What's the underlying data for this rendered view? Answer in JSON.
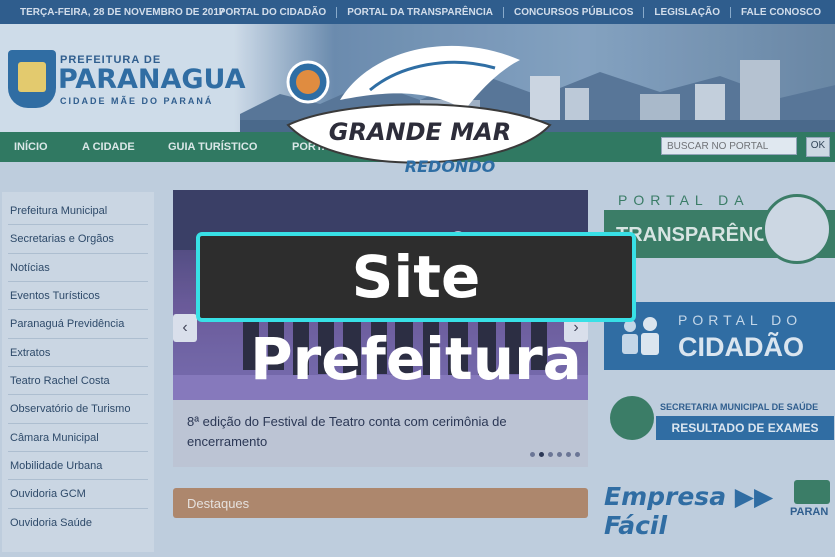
{
  "topbar": {
    "date": "TERÇA-FEIRA, 28 DE NOVEMBRO DE 2017",
    "links": [
      "PORTAL DO CIDADÃO",
      "PORTAL DA TRANSPARÊNCIA",
      "CONCURSOS PÚBLICOS",
      "LEGISLAÇÃO",
      "FALE CONOSCO"
    ]
  },
  "header": {
    "brand_top": "PREFEITURA DE",
    "brand_main": "PARANAGUA",
    "brand_sub": "CIDADE MÃE DO PARANÁ"
  },
  "nav": {
    "items": [
      "INÍCIO",
      "A CIDADE",
      "GUIA TURÍSTICO",
      "PORTAL"
    ],
    "search_placeholder": "BUSCAR NO PORTAL",
    "search_button": "OK"
  },
  "sidebar": {
    "items": [
      "Prefeitura Municipal",
      "Secretarias e Orgãos",
      "Notícias",
      "Eventos Turísticos",
      "Paranaguá Previdência",
      "Extratos",
      "Teatro Rachel Costa",
      "Observatório de Turismo",
      "Câmara Municipal",
      "Mobilidade Urbana",
      "Ouvidoria GCM",
      "Ouvidoria Saúde"
    ]
  },
  "slider": {
    "caption": "8ª edição do Festival de Teatro conta com cerimônia de encerramento",
    "prev": "‹",
    "next": "›",
    "dot_count": 6,
    "active_dot": 1
  },
  "destaques": {
    "label": "Destaques"
  },
  "right": {
    "transp_top": "PORTAL DA",
    "transp_main": "TRANSPARÊNCIA",
    "cid_top": "PORTAL DO",
    "cid_main": "CIDADÃO",
    "saude_label": "SECRETARIA MUNICIPAL DE SAÚDE",
    "saude_button": "RESULTADO DE EXAMES",
    "empresa": "Empresa ▶▶ Fácil",
    "parana": "PARAN"
  },
  "overlay": {
    "logo_top": "GRANDE MAR",
    "logo_bottom": "REDONDO",
    "title": "Site Prefeitura"
  },
  "colors": {
    "topbar": "#2e5d8c",
    "navbar": "#2f7b5e",
    "accent_blue": "#2f6ea4",
    "accent_green": "#3b7f63",
    "overlay_border": "#38e0e6"
  }
}
